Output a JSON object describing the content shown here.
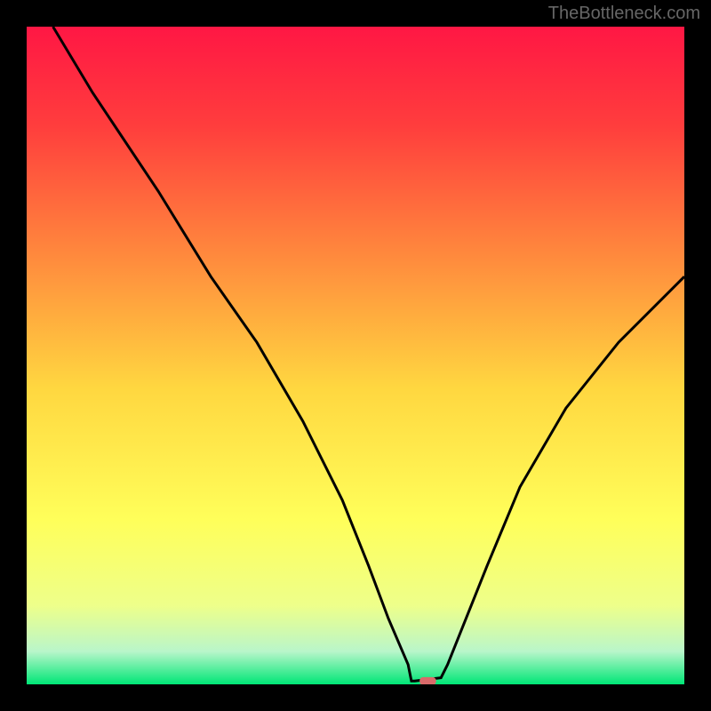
{
  "watermark": "TheBottleneck.com",
  "chart_data": {
    "type": "line",
    "title": "",
    "xlabel": "",
    "ylabel": "",
    "xlim": [
      0,
      100
    ],
    "ylim": [
      0,
      100
    ],
    "background_gradient": {
      "stops": [
        {
          "offset": 0,
          "color": "#ff1744"
        },
        {
          "offset": 15,
          "color": "#ff3d3d"
        },
        {
          "offset": 35,
          "color": "#ff8a3d"
        },
        {
          "offset": 55,
          "color": "#ffd740"
        },
        {
          "offset": 75,
          "color": "#ffff5a"
        },
        {
          "offset": 88,
          "color": "#eeff8a"
        },
        {
          "offset": 95,
          "color": "#b9f6ca"
        },
        {
          "offset": 100,
          "color": "#00e676"
        }
      ]
    },
    "series": [
      {
        "name": "bottleneck-curve",
        "color": "#000000",
        "x": [
          4,
          10,
          20,
          28,
          35,
          42,
          48,
          52,
          55,
          58,
          58.5,
          59,
          63,
          64,
          66,
          70,
          75,
          82,
          90,
          100
        ],
        "y": [
          100,
          90,
          75,
          62,
          52,
          40,
          28,
          18,
          10,
          3,
          0.5,
          0.5,
          1,
          3,
          8,
          18,
          30,
          42,
          52,
          62
        ]
      }
    ],
    "marker": {
      "x": 61,
      "y": 0.5,
      "color": "#d96a6a",
      "width": 2.5,
      "height": 1.2
    }
  }
}
